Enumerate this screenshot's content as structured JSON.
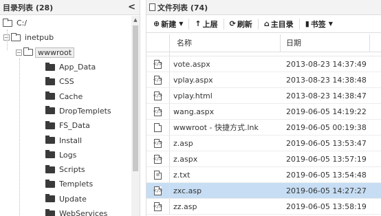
{
  "left_panel": {
    "title": "目录列表 (28)",
    "collapse_symbol": "<",
    "tree": [
      {
        "label": "C:/",
        "level": 0,
        "icon": "folder-open-outline-icon",
        "expander": ""
      },
      {
        "label": "inetpub",
        "level": 1,
        "icon": "folder-open-outline-icon",
        "expander": "−"
      },
      {
        "label": "wwwroot",
        "level": 2,
        "icon": "folder-open-outline-icon",
        "expander": "−",
        "selected": true
      },
      {
        "label": "App_Data",
        "level": 3,
        "icon": "folder-icon"
      },
      {
        "label": "CSS",
        "level": 3,
        "icon": "folder-icon"
      },
      {
        "label": "Cache",
        "level": 3,
        "icon": "folder-icon"
      },
      {
        "label": "DropTemplets",
        "level": 3,
        "icon": "folder-icon"
      },
      {
        "label": "FS_Data",
        "level": 3,
        "icon": "folder-icon"
      },
      {
        "label": "Install",
        "level": 3,
        "icon": "folder-icon"
      },
      {
        "label": "Logs",
        "level": 3,
        "icon": "folder-icon"
      },
      {
        "label": "Scripts",
        "level": 3,
        "icon": "folder-icon"
      },
      {
        "label": "Templets",
        "level": 3,
        "icon": "folder-icon"
      },
      {
        "label": "Update",
        "level": 3,
        "icon": "folder-icon"
      },
      {
        "label": "WebServices",
        "level": 3,
        "icon": "folder-icon"
      }
    ]
  },
  "right_panel": {
    "title": "文件列表 (74)",
    "toolbar": {
      "new_label": "新建",
      "new_icon": "⊕",
      "up_label": "上层",
      "up_icon": "↑",
      "refresh_label": "刷新",
      "refresh_icon": "⟳",
      "home_label": "主目录",
      "home_icon": "⌂",
      "bookmark_label": "书签",
      "bookmark_icon": "▮"
    },
    "columns": {
      "name": "名称",
      "date": "日期"
    },
    "files": [
      {
        "name": "vote.aspx",
        "date": "2013-08-23 14:37:49",
        "icon": "code-file-icon"
      },
      {
        "name": "vplay.aspx",
        "date": "2013-08-23 14:38:48",
        "icon": "code-file-icon"
      },
      {
        "name": "vplay.html",
        "date": "2013-08-23 14:38:47",
        "icon": "code-file-icon"
      },
      {
        "name": "wang.aspx",
        "date": "2019-06-05 14:19:22",
        "icon": "code-file-icon"
      },
      {
        "name": "wwwroot - 快捷方式.lnk",
        "date": "2019-06-05 00:19:38",
        "icon": "blank-file-icon"
      },
      {
        "name": "z.asp",
        "date": "2019-06-05 13:53:47",
        "icon": "code-file-icon"
      },
      {
        "name": "z.aspx",
        "date": "2019-06-05 13:57:19",
        "icon": "code-file-icon"
      },
      {
        "name": "z.txt",
        "date": "2019-06-05 13:54:48",
        "icon": "text-file-icon"
      },
      {
        "name": "zxc.asp",
        "date": "2019-06-05 14:27:27",
        "icon": "code-file-icon",
        "selected": true
      },
      {
        "name": "zz.asp",
        "date": "2019-06-05 13:58:19",
        "icon": "code-file-icon"
      }
    ]
  }
}
